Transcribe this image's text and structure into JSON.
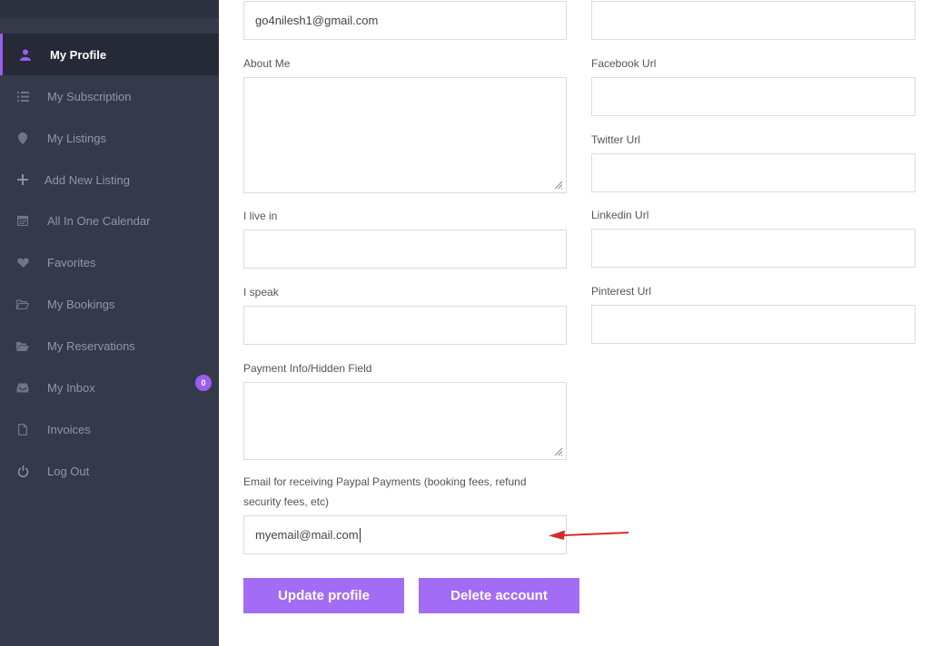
{
  "sidebar": {
    "items": [
      {
        "label": "My Profile",
        "icon": "user-icon"
      },
      {
        "label": "My Subscription",
        "icon": "list-icon"
      },
      {
        "label": "My Listings",
        "icon": "map-pin-icon"
      },
      {
        "label": "Add New Listing",
        "icon": "plus-icon"
      },
      {
        "label": "All In One Calendar",
        "icon": "calendar-icon"
      },
      {
        "label": "Favorites",
        "icon": "heart-icon"
      },
      {
        "label": "My Bookings",
        "icon": "folder-open-icon"
      },
      {
        "label": "My Reservations",
        "icon": "folder-icon"
      },
      {
        "label": "My Inbox",
        "icon": "inbox-icon"
      },
      {
        "label": "Invoices",
        "icon": "file-icon"
      },
      {
        "label": "Log Out",
        "icon": "power-icon"
      }
    ],
    "inbox_badge": "0"
  },
  "form": {
    "email_value": "go4nilesh1@gmail.com",
    "about_label": "About Me",
    "live_label": "I live in",
    "speak_label": "I speak",
    "payment_label": "Payment Info/Hidden Field",
    "paypal_label_line1": "Email for receiving Paypal Payments (booking fees, refund",
    "paypal_label_line2": "security fees, etc)",
    "paypal_value": "myemail@mail.com",
    "facebook_label": "Facebook Url",
    "twitter_label": "Twitter Url",
    "linkedin_label": "Linkedin Url",
    "pinterest_label": "Pinterest Url"
  },
  "buttons": {
    "update": "Update profile",
    "delete": "Delete account"
  },
  "colors": {
    "sidebar_bg": "#343a4a",
    "accent": "#9c5cf2",
    "button": "#a36cf5",
    "arrow": "#d62b2b"
  }
}
